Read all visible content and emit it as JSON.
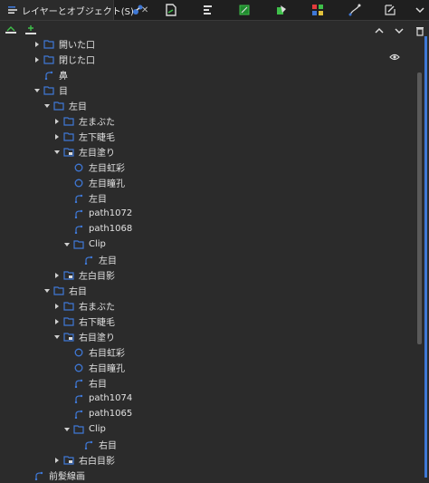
{
  "panel": {
    "tab_title": "レイヤーとオブジェクト(S)",
    "close_glyph": "✕"
  },
  "accent_color": "#3f78d6",
  "tree": [
    {
      "depth": 1,
      "chev": "right",
      "icon": "folder",
      "label": "開いた口"
    },
    {
      "depth": 1,
      "chev": "right",
      "icon": "folder",
      "label": "閉じた口"
    },
    {
      "depth": 1,
      "chev": "none",
      "icon": "path",
      "label": "鼻"
    },
    {
      "depth": 1,
      "chev": "down",
      "icon": "folder",
      "label": "目"
    },
    {
      "depth": 2,
      "chev": "down",
      "icon": "folder",
      "label": "左目"
    },
    {
      "depth": 3,
      "chev": "right",
      "icon": "folder",
      "label": "左まぶた"
    },
    {
      "depth": 3,
      "chev": "right",
      "icon": "folder",
      "label": "左下睫毛"
    },
    {
      "depth": 3,
      "chev": "down",
      "icon": "clipfolder",
      "label": "左目塗り"
    },
    {
      "depth": 4,
      "chev": "none",
      "icon": "circle",
      "label": "左目虹彩"
    },
    {
      "depth": 4,
      "chev": "none",
      "icon": "circle",
      "label": "左目瞳孔"
    },
    {
      "depth": 4,
      "chev": "none",
      "icon": "path",
      "label": "左目"
    },
    {
      "depth": 4,
      "chev": "none",
      "icon": "path",
      "label": "path1072"
    },
    {
      "depth": 4,
      "chev": "none",
      "icon": "path",
      "label": "path1068"
    },
    {
      "depth": 4,
      "chev": "down",
      "icon": "folder",
      "label": "Clip"
    },
    {
      "depth": 5,
      "chev": "none",
      "icon": "path",
      "label": "左目"
    },
    {
      "depth": 3,
      "chev": "right",
      "icon": "clipfolder",
      "label": "左白目影"
    },
    {
      "depth": 2,
      "chev": "down",
      "icon": "folder",
      "label": "右目"
    },
    {
      "depth": 3,
      "chev": "right",
      "icon": "folder",
      "label": "右まぶた"
    },
    {
      "depth": 3,
      "chev": "right",
      "icon": "folder",
      "label": "右下睫毛"
    },
    {
      "depth": 3,
      "chev": "down",
      "icon": "clipfolder",
      "label": "右目塗り"
    },
    {
      "depth": 4,
      "chev": "none",
      "icon": "circle",
      "label": "右目虹彩"
    },
    {
      "depth": 4,
      "chev": "none",
      "icon": "circle",
      "label": "右目瞳孔"
    },
    {
      "depth": 4,
      "chev": "none",
      "icon": "path",
      "label": "右目"
    },
    {
      "depth": 4,
      "chev": "none",
      "icon": "path",
      "label": "path1074"
    },
    {
      "depth": 4,
      "chev": "none",
      "icon": "path",
      "label": "path1065"
    },
    {
      "depth": 4,
      "chev": "down",
      "icon": "folder",
      "label": "Clip"
    },
    {
      "depth": 5,
      "chev": "none",
      "icon": "path",
      "label": "右目"
    },
    {
      "depth": 3,
      "chev": "right",
      "icon": "clipfolder",
      "label": "右白目影"
    },
    {
      "depth": 0,
      "chev": "none",
      "icon": "path",
      "label": "前髪線画"
    }
  ]
}
